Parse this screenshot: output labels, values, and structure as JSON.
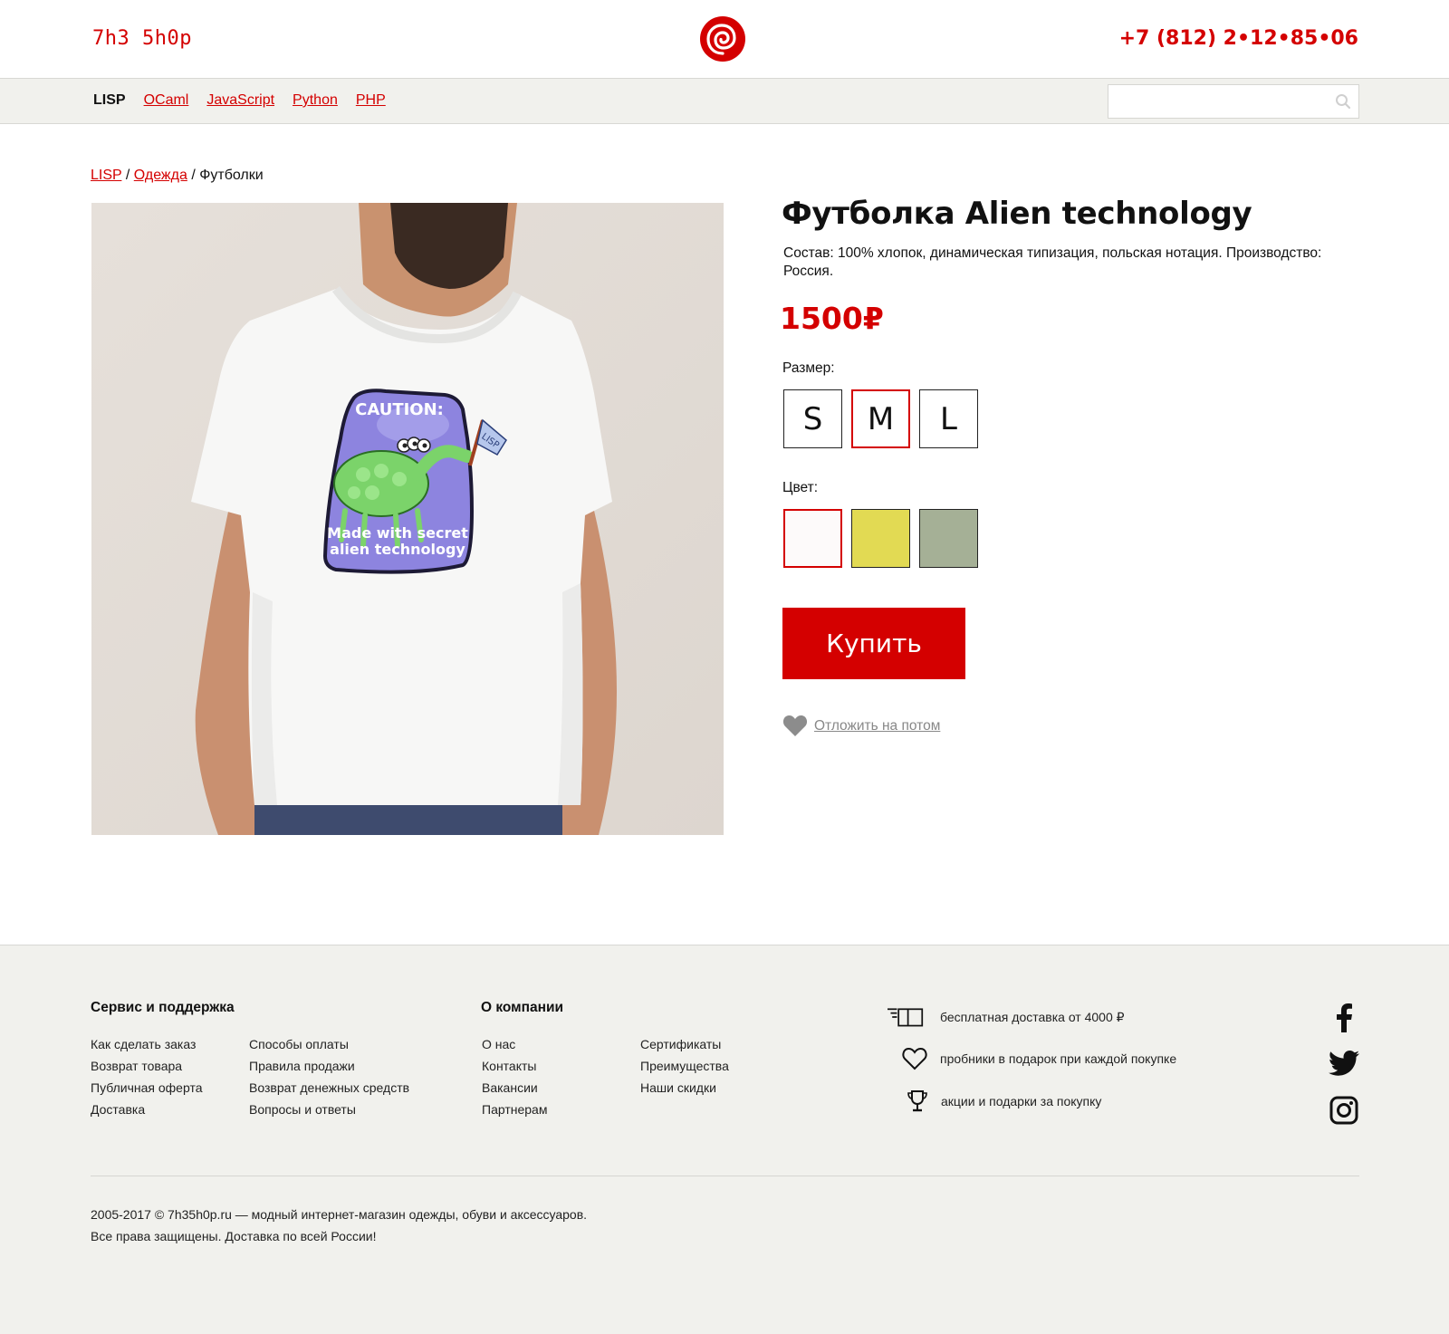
{
  "header": {
    "logo_text": "7h3 5h0p",
    "phone": "+7 (812) 2•12•85•06"
  },
  "nav": {
    "items": [
      {
        "label": "LISP",
        "active": true
      },
      {
        "label": "OCaml"
      },
      {
        "label": "JavaScript"
      },
      {
        "label": "Python"
      },
      {
        "label": "PHP"
      }
    ],
    "search_placeholder": ""
  },
  "breadcrumb": {
    "items": [
      "LISP",
      "Одежда"
    ],
    "current": "Футболки",
    "separator": "/"
  },
  "product": {
    "title": "Футболка Alien technology",
    "description": "Состав: 100% хлопок, динамическая типизация, польская нотация. Производство: Россия.",
    "price": "1500₽",
    "size_label": "Размер:",
    "sizes": [
      "S",
      "M",
      "L"
    ],
    "selected_size": "M",
    "color_label": "Цвет:",
    "colors": [
      "#fdfafa",
      "#e2da53",
      "#a5b096"
    ],
    "selected_color": 0,
    "buy_label": "Купить",
    "wishlist_label": "Отложить на потом",
    "print_caution": "CAUTION:",
    "print_text_line1": "Made with secret",
    "print_text_line2": "alien technology",
    "print_flag": "LISP"
  },
  "footer": {
    "service_heading": "Сервис и поддержка",
    "service_col1": [
      "Как сделать заказ",
      "Возврат товара",
      "Публичная оферта",
      "Доставка"
    ],
    "service_col2": [
      "Способы оплаты",
      "Правила продажи",
      "Возврат денежных средств",
      "Вопросы и ответы"
    ],
    "company_heading": "О компании",
    "company_col1": [
      "О нас",
      "Контакты",
      "Вакансии",
      "Партнерам"
    ],
    "company_col2": [
      "Сертификаты",
      "Преимущества",
      "Наши скидки"
    ],
    "perks": [
      "бесплатная доставка от 4000 ₽",
      "пробники в подарок при каждой покупке",
      "акции и подарки за покупку"
    ],
    "copyright_line1": "2005-2017 © 7h35h0p.ru — модный интернет-магазин одежды, обуви и аксессуаров.",
    "copyright_line2": "Все права защищены. Доставка по всей России!"
  },
  "colors": {
    "accent": "#d40000",
    "footer_bg": "#f1f1ed",
    "nav_bg": "#f1f1ed"
  },
  "icons": [
    "spiral-logo-icon",
    "search-icon",
    "heart-icon",
    "truck-icon",
    "heart-outline-icon",
    "trophy-icon",
    "facebook-icon",
    "twitter-icon",
    "instagram-icon"
  ]
}
